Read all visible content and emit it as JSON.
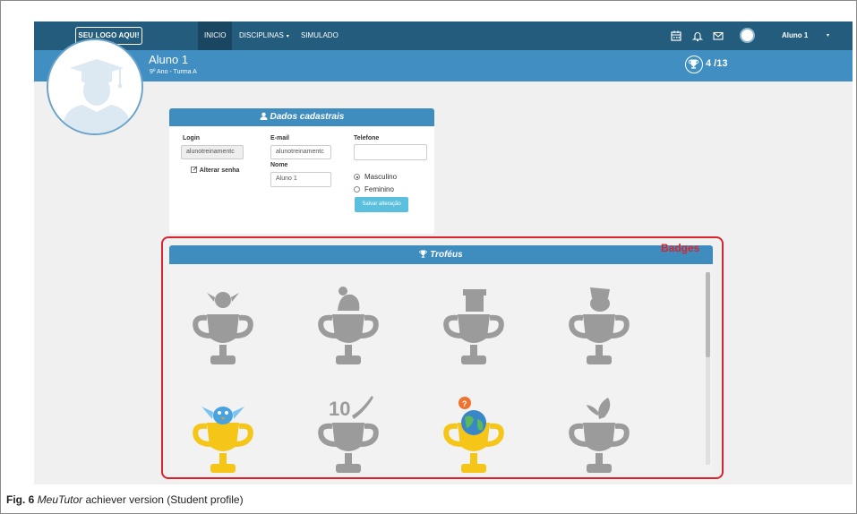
{
  "nav": {
    "logo": "SEU LOGO AQUI!",
    "items": [
      {
        "label": "INICIO",
        "active": true
      },
      {
        "label": "DISCIPLINAS",
        "caret": "▾"
      },
      {
        "label": "SIMULADO"
      }
    ],
    "icons": [
      "calendar-icon",
      "bell-icon",
      "mail-icon"
    ],
    "user": "Aluno 1",
    "user_caret": "▾"
  },
  "header": {
    "name": "Aluno 1",
    "class": "9º Ano - Turma A",
    "trophy_count": "4 /13"
  },
  "dados": {
    "title": "Dados cadastrais",
    "login_label": "Login",
    "login_value": "alunotreinamentc",
    "email_label": "E-mail",
    "email_value": "alunotreinamentc",
    "phone_label": "Telefone",
    "phone_value": "",
    "name_label": "Nome",
    "name_value": "Aluno 1",
    "change_password": "Alterar senha",
    "gender_options": [
      "Masculino",
      "Feminino"
    ],
    "gender_selected": "Masculino",
    "save_button": "Salvar alteração"
  },
  "annotation": {
    "badges": "Badges"
  },
  "trofeus": {
    "title": "Troféus",
    "trophies": [
      {
        "topper": "bird",
        "earned": false
      },
      {
        "topper": "cap",
        "earned": false
      },
      {
        "topper": "graduate",
        "earned": false
      },
      {
        "topper": "hat",
        "earned": false
      },
      {
        "topper": "bird",
        "earned": true
      },
      {
        "topper": "ten",
        "earned": false
      },
      {
        "topper": "globe",
        "earned": true
      },
      {
        "topper": "leaf",
        "earned": false
      }
    ],
    "ten_label": "10"
  },
  "caption": {
    "fig": "Fig. 6",
    "app": "MeuTutor",
    "rest": " achiever version (Student profile)"
  },
  "colors": {
    "nav": "#235c7c",
    "band": "#418fc2",
    "panel_head": "#3f8cbf",
    "annotation_red": "#d9242f",
    "trophy_grey": "#9b9b9b",
    "trophy_gold": "#f5c518"
  }
}
